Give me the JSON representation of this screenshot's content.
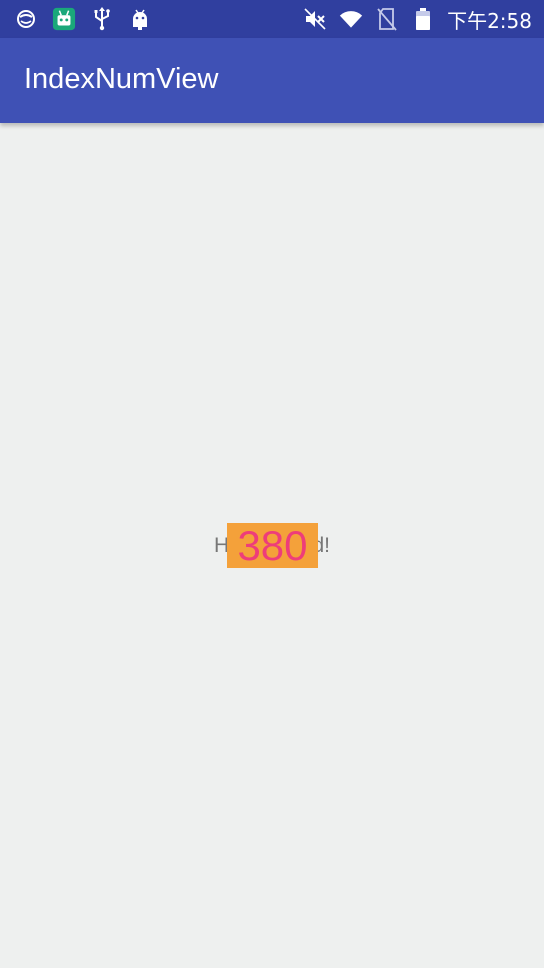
{
  "status_bar": {
    "time": "下午2:58",
    "icons_left": [
      "notification-icon",
      "app-icon",
      "usb-icon",
      "android-debug-icon"
    ],
    "icons_right": [
      "mute-icon",
      "wifi-icon",
      "no-sim-icon",
      "battery-icon"
    ]
  },
  "app_bar": {
    "title": "IndexNumView"
  },
  "main": {
    "hello_prefix": "H",
    "hello_suffix": "d!",
    "index_number": "380"
  },
  "colors": {
    "status_bar": "#303f9f",
    "app_bar": "#3f51b5",
    "background": "#eef0ef",
    "number_bg": "#f4a13a",
    "number_text": "#ee3d7a"
  }
}
